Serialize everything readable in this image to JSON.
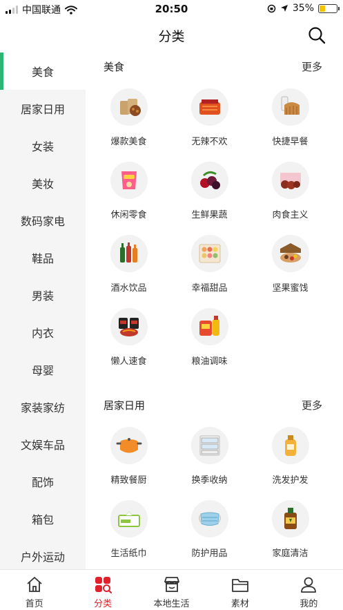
{
  "status_bar": {
    "carrier": "中国联通",
    "time": "20:50",
    "battery": "35%",
    "battery_level": 0.35,
    "battery_color": "#f5c400"
  },
  "header": {
    "title": "分类",
    "search_icon": "search-icon"
  },
  "colors": {
    "accent": "#2bb673",
    "active_tab": "#e0202a"
  },
  "sidebar": {
    "items": [
      {
        "label": "美食",
        "active": true
      },
      {
        "label": "居家日用"
      },
      {
        "label": "女装"
      },
      {
        "label": "美妆"
      },
      {
        "label": "数码家电"
      },
      {
        "label": "鞋品"
      },
      {
        "label": "男装"
      },
      {
        "label": "内衣"
      },
      {
        "label": "母婴"
      },
      {
        "label": "家装家纺"
      },
      {
        "label": "文娱车品"
      },
      {
        "label": "配饰"
      },
      {
        "label": "箱包"
      },
      {
        "label": "户外运动"
      }
    ]
  },
  "sections": [
    {
      "title": "美食",
      "more": "更多",
      "items": [
        {
          "label": "爆款美食",
          "icon": "snack-bags-icon"
        },
        {
          "label": "无辣不欢",
          "icon": "spicy-meat-icon"
        },
        {
          "label": "快捷早餐",
          "icon": "bread-milk-icon"
        },
        {
          "label": "休闲零食",
          "icon": "chips-bag-icon"
        },
        {
          "label": "生鲜果蔬",
          "icon": "fruit-icon"
        },
        {
          "label": "肉食主义",
          "icon": "beef-jerky-icon"
        },
        {
          "label": "酒水饮品",
          "icon": "bottles-icon"
        },
        {
          "label": "幸福甜品",
          "icon": "macaron-box-icon"
        },
        {
          "label": "坚果蜜饯",
          "icon": "nuts-box-icon"
        },
        {
          "label": "懒人速食",
          "icon": "instant-noodles-icon"
        },
        {
          "label": "粮油调味",
          "icon": "rice-oil-icon"
        }
      ]
    },
    {
      "title": "居家日用",
      "more": "更多",
      "items": [
        {
          "label": "精致餐厨",
          "icon": "pot-icon"
        },
        {
          "label": "换季收纳",
          "icon": "storage-drawer-icon"
        },
        {
          "label": "洗发护发",
          "icon": "shampoo-icon"
        },
        {
          "label": "生活纸巾",
          "icon": "tissue-icon"
        },
        {
          "label": "防护用品",
          "icon": "mask-icon"
        },
        {
          "label": "家庭清洁",
          "icon": "disinfectant-icon"
        }
      ]
    }
  ],
  "tabbar": {
    "tabs": [
      {
        "label": "首页",
        "icon": "home-icon"
      },
      {
        "label": "分类",
        "icon": "category-icon",
        "active": true
      },
      {
        "label": "本地生活",
        "icon": "store-icon"
      },
      {
        "label": "素材",
        "icon": "folder-icon"
      },
      {
        "label": "我的",
        "icon": "profile-icon"
      }
    ]
  }
}
